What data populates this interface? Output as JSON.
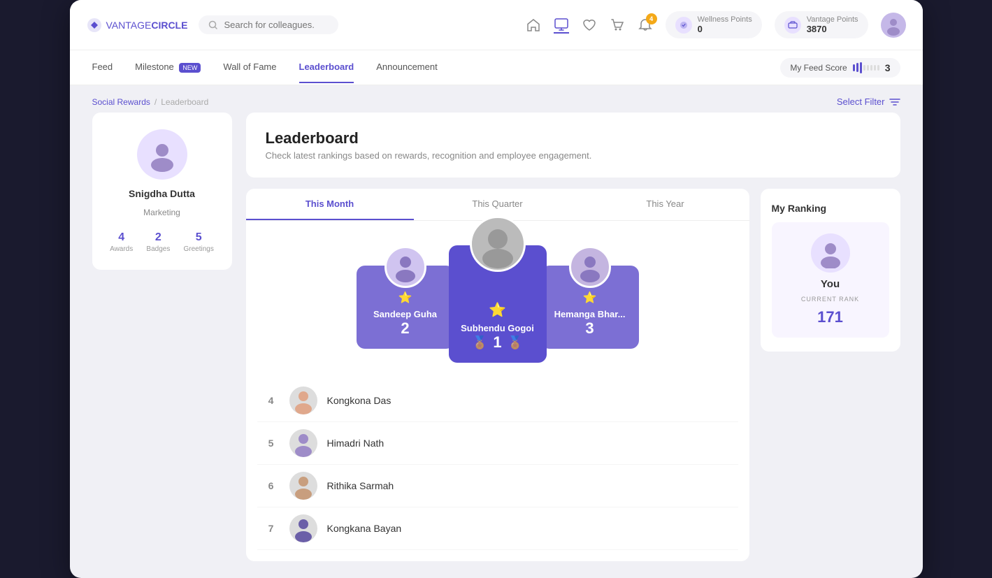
{
  "app": {
    "title": "VantageCircle"
  },
  "topNav": {
    "search_placeholder": "Search for colleagues...",
    "wellness_label": "Wellness Points",
    "wellness_value": "0",
    "vantage_label": "Vantage Points",
    "vantage_value": "3870",
    "notification_count": "4"
  },
  "subNav": {
    "items": [
      {
        "label": "Feed",
        "active": false
      },
      {
        "label": "Milestone",
        "active": false,
        "badge": "NEW"
      },
      {
        "label": "Wall of Fame",
        "active": false
      },
      {
        "label": "Leaderboard",
        "active": true
      },
      {
        "label": "Announcement",
        "active": false
      }
    ],
    "feed_score_label": "My Feed Score",
    "feed_score_value": "3"
  },
  "breadcrumb": {
    "parent": "Social Rewards",
    "current": "Leaderboard",
    "filter_label": "Select Filter"
  },
  "leftPanel": {
    "name": "Snigdha Dutta",
    "department": "Marketing",
    "stats": [
      {
        "value": "4",
        "label": "Awards"
      },
      {
        "value": "2",
        "label": "Badges"
      },
      {
        "value": "5",
        "label": "Greetings"
      }
    ]
  },
  "leaderboard": {
    "title": "Leaderboard",
    "subtitle": "Check latest rankings based on rewards, recognition and employee engagement.",
    "tabs": [
      {
        "label": "This Month",
        "active": true
      },
      {
        "label": "This Quarter",
        "active": false
      },
      {
        "label": "This Year",
        "active": false
      }
    ],
    "podium": [
      {
        "rank": 2,
        "name": "Sandeep Guha",
        "position": "left"
      },
      {
        "rank": 1,
        "name": "Subhendu Gogoi",
        "position": "center"
      },
      {
        "rank": 3,
        "name": "Hemanga Bhar...",
        "position": "right"
      }
    ],
    "list": [
      {
        "rank": 4,
        "name": "Kongkona Das"
      },
      {
        "rank": 5,
        "name": "Himadri Nath"
      },
      {
        "rank": 6,
        "name": "Rithika Sarmah"
      },
      {
        "rank": 7,
        "name": "Kongkana Bayan"
      }
    ],
    "myRanking": {
      "title": "My Ranking",
      "you_label": "You",
      "rank_label": "CURRENT RANK",
      "rank_value": "171"
    }
  }
}
